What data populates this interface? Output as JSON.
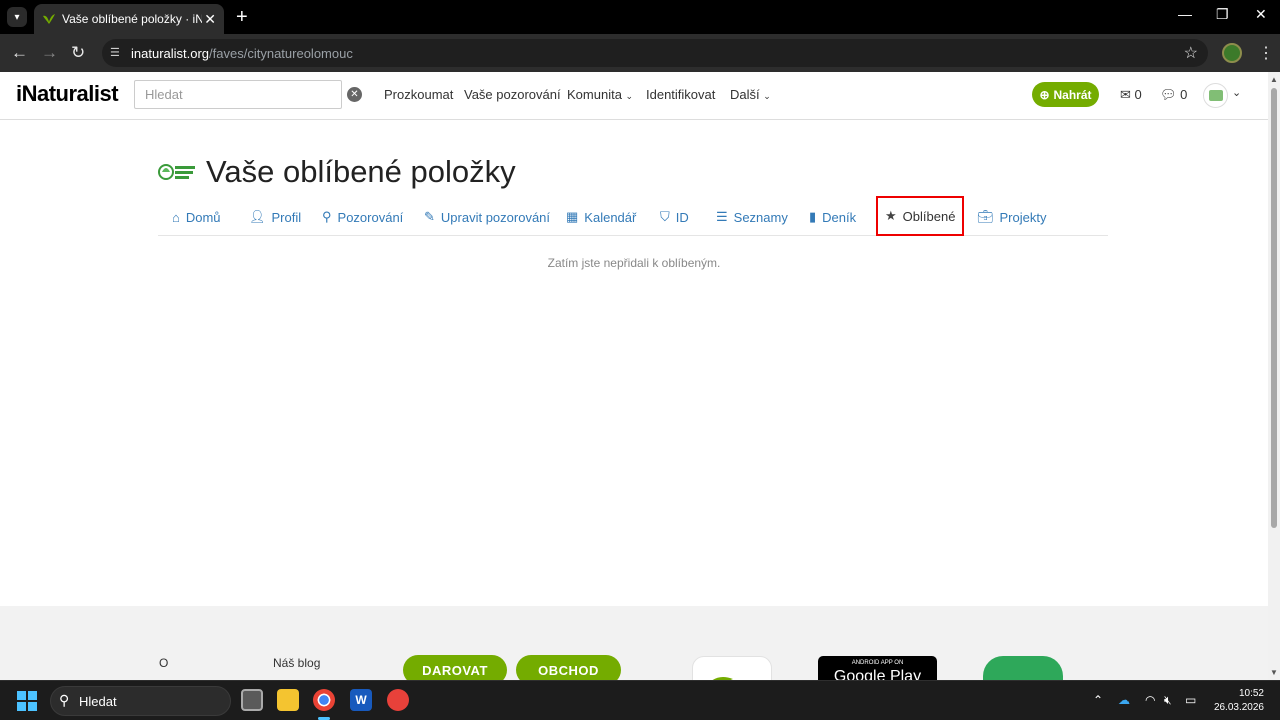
{
  "browser": {
    "tab_title": "Vaše oblíbené položky · iNaturalist",
    "url_domain": "inaturalist.org",
    "url_path": "/faves/citynatureolomouc"
  },
  "header": {
    "logo": "iNaturalist",
    "search_placeholder": "Hledat",
    "nav": [
      {
        "label": "Prozkoumat"
      },
      {
        "label": "Vaše pozorování"
      },
      {
        "label": "Komunita"
      },
      {
        "label": "Identifikovat"
      },
      {
        "label": "Další"
      }
    ],
    "upload_label": "Nahrát",
    "messages_count": "0",
    "notifications_count": "0"
  },
  "page": {
    "title": "Vaše oblíbené položky",
    "tabs": [
      {
        "label": "Domů",
        "icon": "home-icon"
      },
      {
        "label": "Profil",
        "icon": "user-icon"
      },
      {
        "label": "Pozorování",
        "icon": "binoculars-icon"
      },
      {
        "label": "Upravit pozorování",
        "icon": "pencil-icon"
      },
      {
        "label": "Kalendář",
        "icon": "calendar-icon"
      },
      {
        "label": "ID",
        "icon": "tag-icon"
      },
      {
        "label": "Seznamy",
        "icon": "list-icon"
      },
      {
        "label": "Deník",
        "icon": "book-icon"
      },
      {
        "label": "Oblíbené",
        "icon": "star-icon",
        "active": true
      },
      {
        "label": "Projekty",
        "icon": "briefcase-icon"
      }
    ],
    "empty_message": "Zatím jste nepřidali k oblíbeným."
  },
  "footer": {
    "links": [
      "O",
      "Náš blog"
    ],
    "donate_label": "DAROVAT",
    "shop_label": "OBCHOD",
    "google_play_top": "ANDROID APP ON",
    "google_play_bottom": "Google Play"
  },
  "taskbar": {
    "search_placeholder": "Hledat",
    "time": "10:52",
    "date": "26.03.2026"
  },
  "colors": {
    "brand_green": "#74ac00",
    "link_blue": "#337ab7",
    "active_tab_border": "#e00000"
  }
}
